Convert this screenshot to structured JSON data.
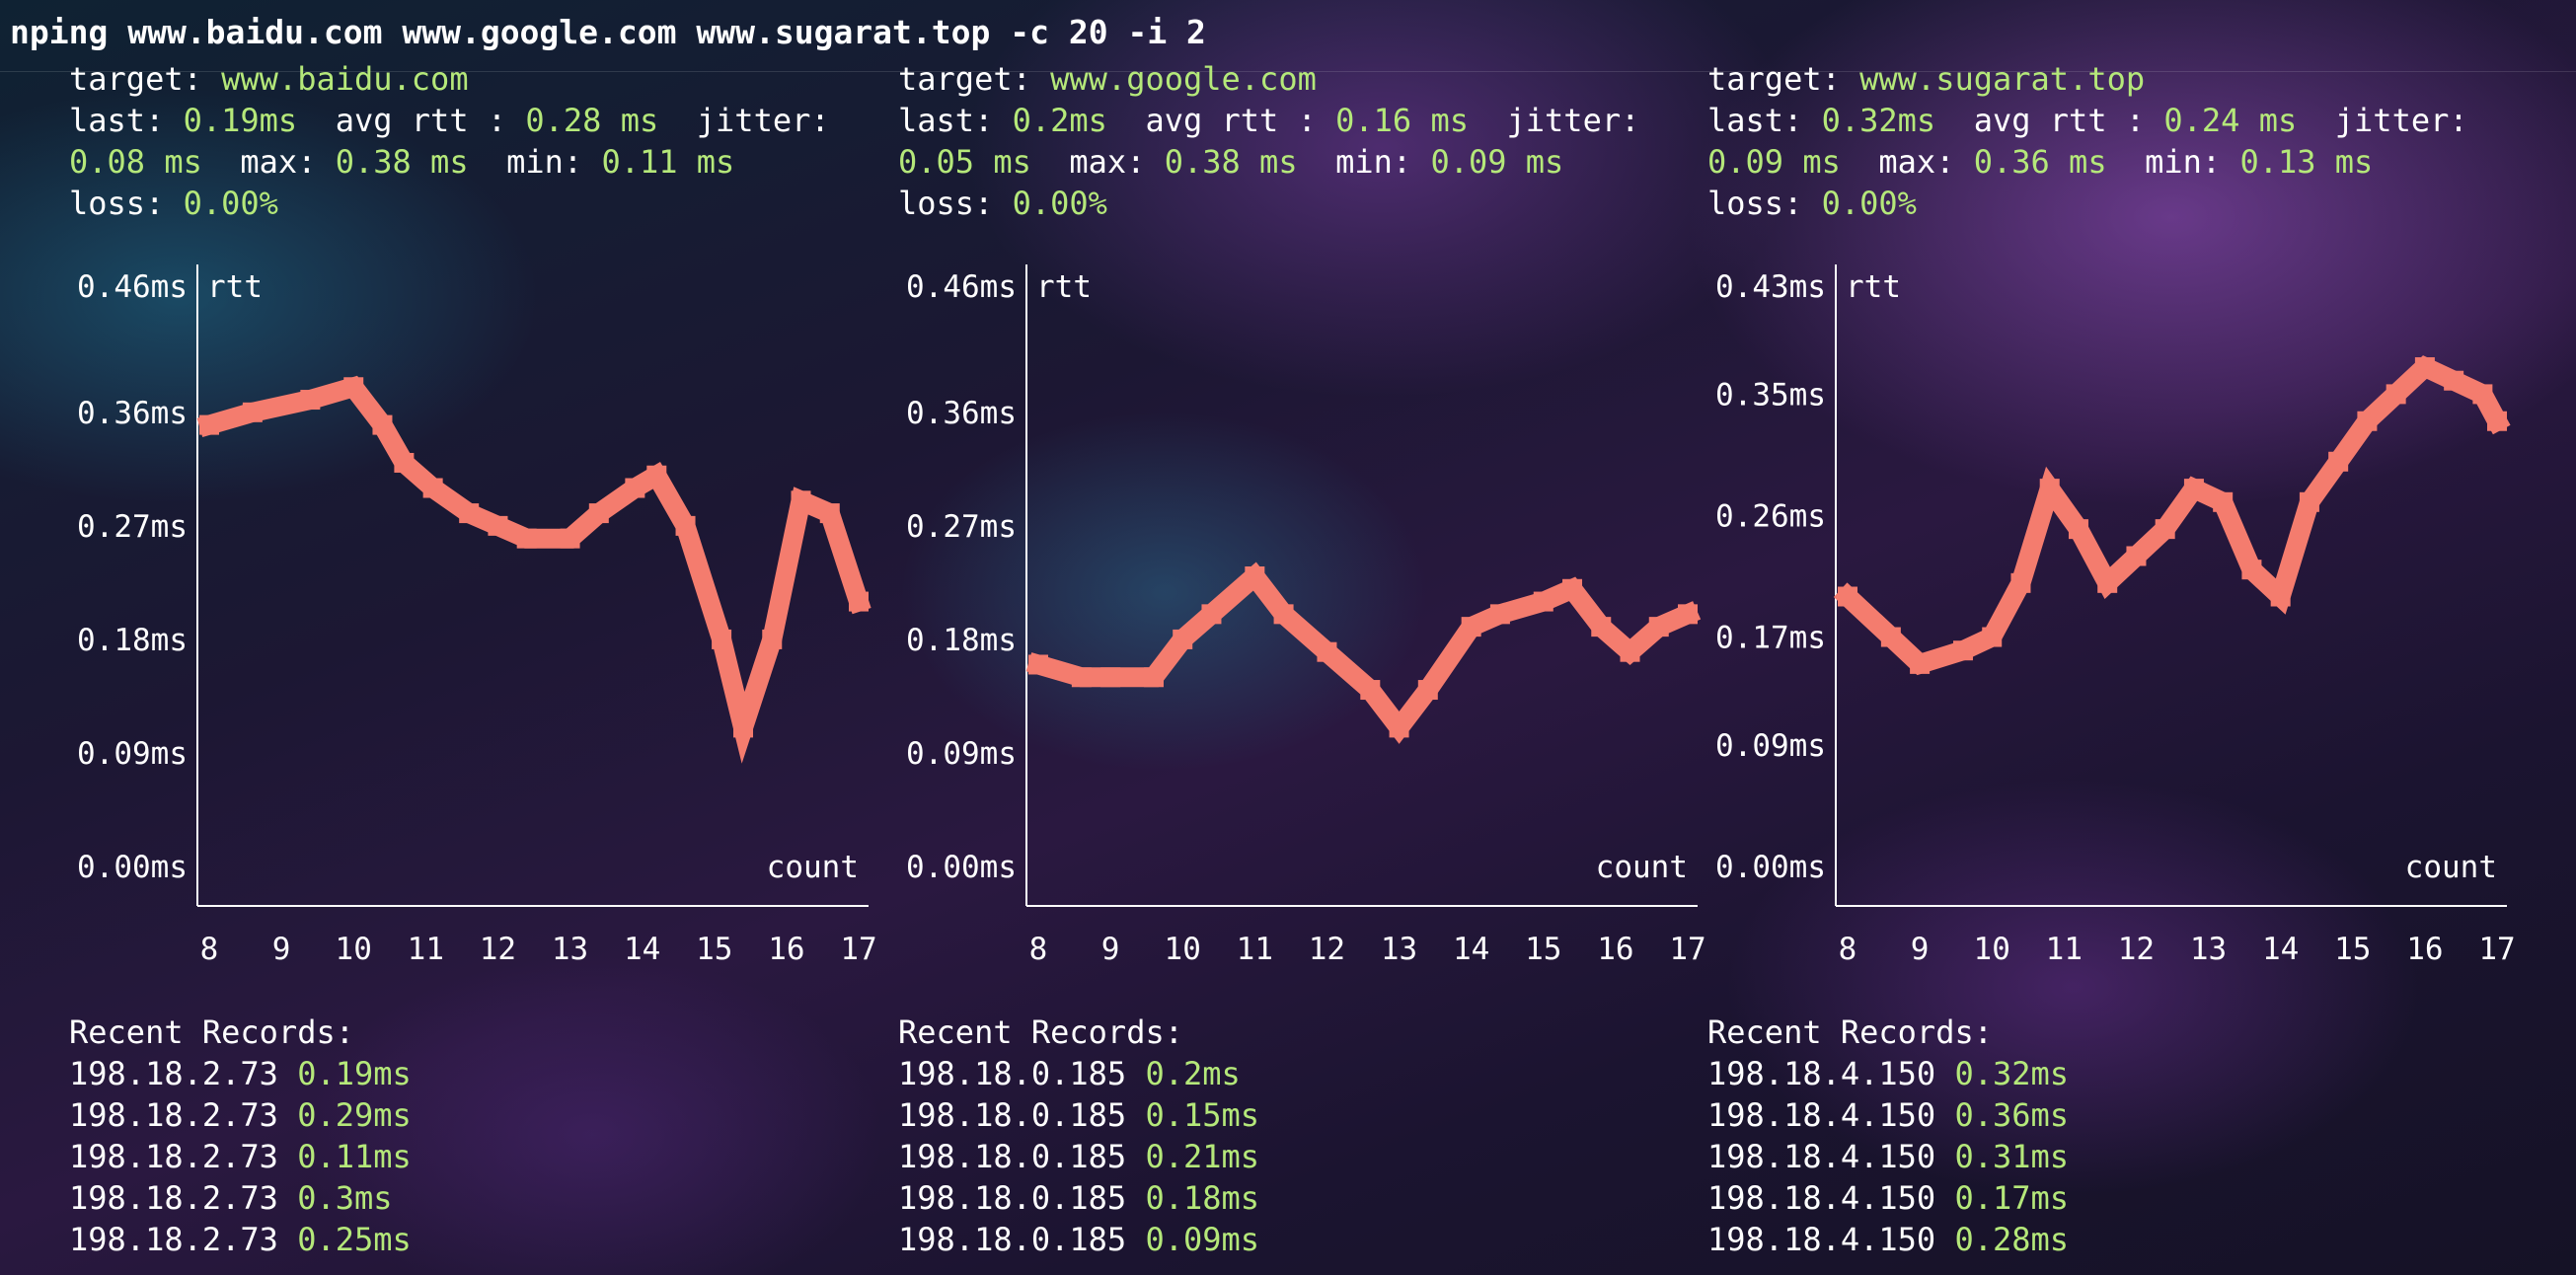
{
  "command": "nping www.baidu.com www.google.com www.sugarat.top -c 20 -i 2",
  "labels": {
    "target": "target:",
    "last": "last:",
    "avg_rtt": "avg rtt :",
    "jitter": "jitter:",
    "max": "max:",
    "min": "min:",
    "loss": "loss:",
    "recent_records": "Recent Records:"
  },
  "panels": [
    {
      "target": "www.baidu.com",
      "last": "0.19ms",
      "avg_rtt": "0.28 ms",
      "jitter": "0.08 ms",
      "max": "0.38 ms",
      "min": "0.11 ms",
      "loss": "0.00%",
      "records": [
        {
          "ip": "198.18.2.73",
          "rtt": "0.19ms"
        },
        {
          "ip": "198.18.2.73",
          "rtt": "0.29ms"
        },
        {
          "ip": "198.18.2.73",
          "rtt": "0.11ms"
        },
        {
          "ip": "198.18.2.73",
          "rtt": "0.3ms"
        },
        {
          "ip": "198.18.2.73",
          "rtt": "0.25ms"
        }
      ],
      "chart_data": {
        "type": "line",
        "ylabel": "rtt",
        "xlabel": "count",
        "line_color": "#f47c6e",
        "y_ticks": [
          "0.46ms",
          "0.36ms",
          "0.27ms",
          "0.18ms",
          "0.09ms",
          "0.00ms"
        ],
        "y_tick_values": [
          0.46,
          0.36,
          0.27,
          0.18,
          0.09,
          0.0
        ],
        "x_ticks": [
          "8",
          "9",
          "10",
          "11",
          "12",
          "13",
          "14",
          "15",
          "16",
          "17"
        ],
        "x_tick_values": [
          8,
          9,
          10,
          11,
          12,
          13,
          14,
          15,
          16,
          17
        ],
        "x": [
          8.0,
          8.6,
          9.4,
          10.0,
          10.4,
          10.7,
          11.1,
          11.6,
          12.0,
          12.4,
          13.0,
          13.4,
          13.9,
          14.2,
          14.6,
          15.1,
          15.4,
          15.8,
          16.2,
          16.6,
          17.0
        ],
        "y": [
          0.35,
          0.36,
          0.37,
          0.38,
          0.35,
          0.32,
          0.3,
          0.28,
          0.27,
          0.26,
          0.26,
          0.28,
          0.3,
          0.31,
          0.27,
          0.18,
          0.11,
          0.18,
          0.29,
          0.28,
          0.21
        ]
      }
    },
    {
      "target": "www.google.com",
      "last": "0.2ms",
      "avg_rtt": "0.16 ms",
      "jitter": "0.05 ms",
      "max": "0.38 ms",
      "min": "0.09 ms",
      "loss": "0.00%",
      "records": [
        {
          "ip": "198.18.0.185",
          "rtt": "0.2ms"
        },
        {
          "ip": "198.18.0.185",
          "rtt": "0.15ms"
        },
        {
          "ip": "198.18.0.185",
          "rtt": "0.21ms"
        },
        {
          "ip": "198.18.0.185",
          "rtt": "0.18ms"
        },
        {
          "ip": "198.18.0.185",
          "rtt": "0.09ms"
        }
      ],
      "chart_data": {
        "type": "line",
        "ylabel": "rtt",
        "xlabel": "count",
        "line_color": "#f47c6e",
        "y_ticks": [
          "0.46ms",
          "0.36ms",
          "0.27ms",
          "0.18ms",
          "0.09ms",
          "0.00ms"
        ],
        "y_tick_values": [
          0.46,
          0.36,
          0.27,
          0.18,
          0.09,
          0.0
        ],
        "x_ticks": [
          "8",
          "9",
          "10",
          "11",
          "12",
          "13",
          "14",
          "15",
          "16",
          "17"
        ],
        "x_tick_values": [
          8,
          9,
          10,
          11,
          12,
          13,
          14,
          15,
          16,
          17
        ],
        "x": [
          8.0,
          8.6,
          9.0,
          9.6,
          10.0,
          10.4,
          11.0,
          11.4,
          12.0,
          12.6,
          13.0,
          13.4,
          14.0,
          14.4,
          15.0,
          15.4,
          15.8,
          16.2,
          16.6,
          17.0
        ],
        "y": [
          0.16,
          0.15,
          0.15,
          0.15,
          0.18,
          0.2,
          0.23,
          0.2,
          0.17,
          0.14,
          0.11,
          0.14,
          0.19,
          0.2,
          0.21,
          0.22,
          0.19,
          0.17,
          0.19,
          0.2
        ]
      }
    },
    {
      "target": "www.sugarat.top",
      "last": "0.32ms",
      "avg_rtt": "0.24 ms",
      "jitter": "0.09 ms",
      "max": "0.36 ms",
      "min": "0.13 ms",
      "loss": "0.00%",
      "records": [
        {
          "ip": "198.18.4.150",
          "rtt": "0.32ms"
        },
        {
          "ip": "198.18.4.150",
          "rtt": "0.36ms"
        },
        {
          "ip": "198.18.4.150",
          "rtt": "0.31ms"
        },
        {
          "ip": "198.18.4.150",
          "rtt": "0.17ms"
        },
        {
          "ip": "198.18.4.150",
          "rtt": "0.28ms"
        }
      ],
      "chart_data": {
        "type": "line",
        "ylabel": "rtt",
        "xlabel": "count",
        "line_color": "#f47c6e",
        "y_ticks": [
          "0.43ms",
          "0.35ms",
          "0.26ms",
          "0.17ms",
          "0.09ms",
          "0.00ms"
        ],
        "y_tick_values": [
          0.43,
          0.35,
          0.26,
          0.17,
          0.09,
          0.0
        ],
        "x_ticks": [
          "8",
          "9",
          "10",
          "11",
          "12",
          "13",
          "14",
          "15",
          "16",
          "17"
        ],
        "x_tick_values": [
          8,
          9,
          10,
          11,
          12,
          13,
          14,
          15,
          16,
          17
        ],
        "x": [
          8.0,
          8.6,
          9.0,
          9.6,
          10.0,
          10.4,
          10.8,
          11.2,
          11.6,
          12.0,
          12.4,
          12.8,
          13.2,
          13.6,
          14.0,
          14.4,
          14.8,
          15.2,
          15.6,
          16.0,
          16.4,
          16.8,
          17.0
        ],
        "y": [
          0.2,
          0.17,
          0.15,
          0.16,
          0.17,
          0.21,
          0.28,
          0.25,
          0.21,
          0.23,
          0.25,
          0.28,
          0.27,
          0.22,
          0.2,
          0.27,
          0.3,
          0.33,
          0.35,
          0.37,
          0.36,
          0.35,
          0.33
        ]
      }
    }
  ]
}
